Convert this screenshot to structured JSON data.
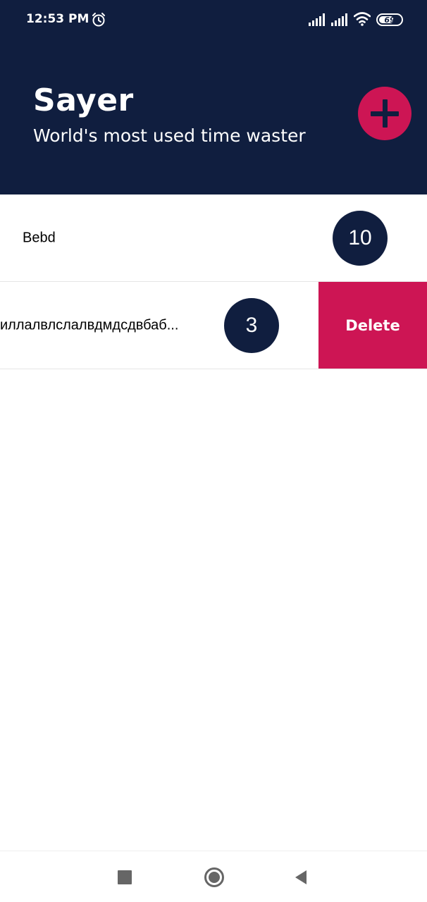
{
  "status_bar": {
    "time": "12:53 PM",
    "battery_level": "69",
    "battery_fraction": 0.69,
    "icons": [
      "alarm-icon",
      "signal-icon",
      "signal-icon",
      "wifi-icon",
      "battery-icon"
    ]
  },
  "header": {
    "title": "Sayer",
    "subtitle": "World's most used time waster",
    "add_button_icon": "plus-icon"
  },
  "items": [
    {
      "label": "Bebd",
      "count": "10"
    },
    {
      "label": "иллалвлслалвдмдсдвбаб...",
      "count": "3",
      "action_label": "Delete"
    }
  ],
  "nav_bar": {
    "icons": [
      "recents-icon",
      "home-icon",
      "back-icon"
    ]
  },
  "colors": {
    "primary": "#101e3f",
    "accent": "#cd1554",
    "background": "#ffffff"
  }
}
